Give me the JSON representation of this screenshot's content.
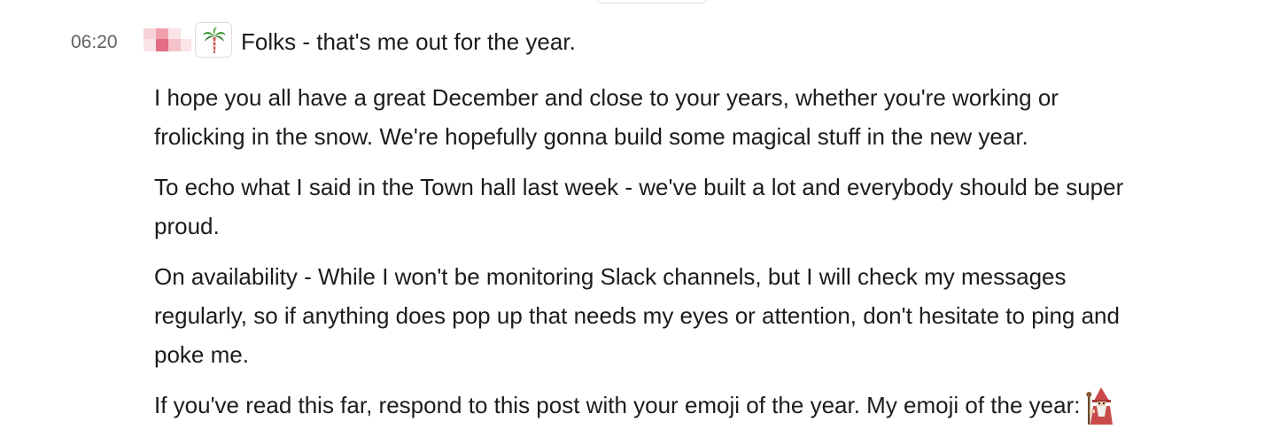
{
  "message": {
    "timestamp": "06:20",
    "first_line": "Folks - that's me out for the year.",
    "paragraphs": [
      "I hope you all have a great December and close to your years, whether you're working or\nfrolicking in the snow. We're hopefully gonna build some magical stuff in the new year.",
      "To echo what I said in the Town hall last week - we've built a lot and everybody should be super\nproud.",
      "On availability - While I won't be monitoring Slack channels, but I will check my messages\nregularly, so if anything does pop up that needs my eyes or attention, don't hesitate to ping and\npoke me.",
      "If you've read this far, respond to this post with your emoji of the year. My emoji of the year:"
    ],
    "status_emoji": "palm-tree-icon",
    "inline_emoji": "wizard-icon"
  },
  "colors": {
    "text": "#1d1c1d",
    "timestamp": "#616061",
    "redacted_name": "#e88a9a",
    "border": "#dddddd"
  }
}
